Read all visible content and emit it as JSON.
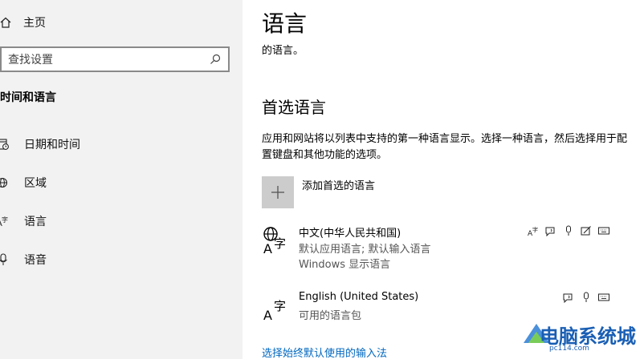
{
  "sidebar": {
    "home_label": "主页",
    "search_placeholder": "查找设置",
    "section_title": "时间和语言",
    "items": [
      {
        "label": "日期和时间",
        "icon": "clock-calendar-icon"
      },
      {
        "label": "区域",
        "icon": "globe-region-icon"
      },
      {
        "label": "语言",
        "icon": "language-icon"
      },
      {
        "label": "语音",
        "icon": "microphone-icon"
      }
    ]
  },
  "main": {
    "title": "语言",
    "subtitle_fragment": "的语言。",
    "preferred_heading": "首选语言",
    "preferred_description": "应用和网站将以列表中支持的第一种语言显示。选择一种语言，然后选择用于配置键盘和其他功能的选项。",
    "add_language_label": "添加首选的语言",
    "languages": [
      {
        "name": "中文(中华人民共和国)",
        "line1": "默认应用语言; 默认输入语言",
        "line2": "Windows 显示语言",
        "features": [
          "display-language-icon",
          "text-to-speech-icon",
          "speech-recognition-icon",
          "handwriting-icon",
          "keyboard-icon"
        ]
      },
      {
        "name": "English (United States)",
        "line1": "可用的语言包",
        "features": [
          "text-to-speech-icon",
          "speech-recognition-icon",
          "keyboard-icon"
        ]
      }
    ],
    "input_method_link": "选择始终默认使用的输入法"
  },
  "watermark": {
    "text": "电脑系统城",
    "url": "pc114.com"
  },
  "colors": {
    "sidebar_bg": "#f2f2f2",
    "add_tile_bg": "#cccccc",
    "link": "#0067c0",
    "watermark": "#1a5fb4"
  }
}
